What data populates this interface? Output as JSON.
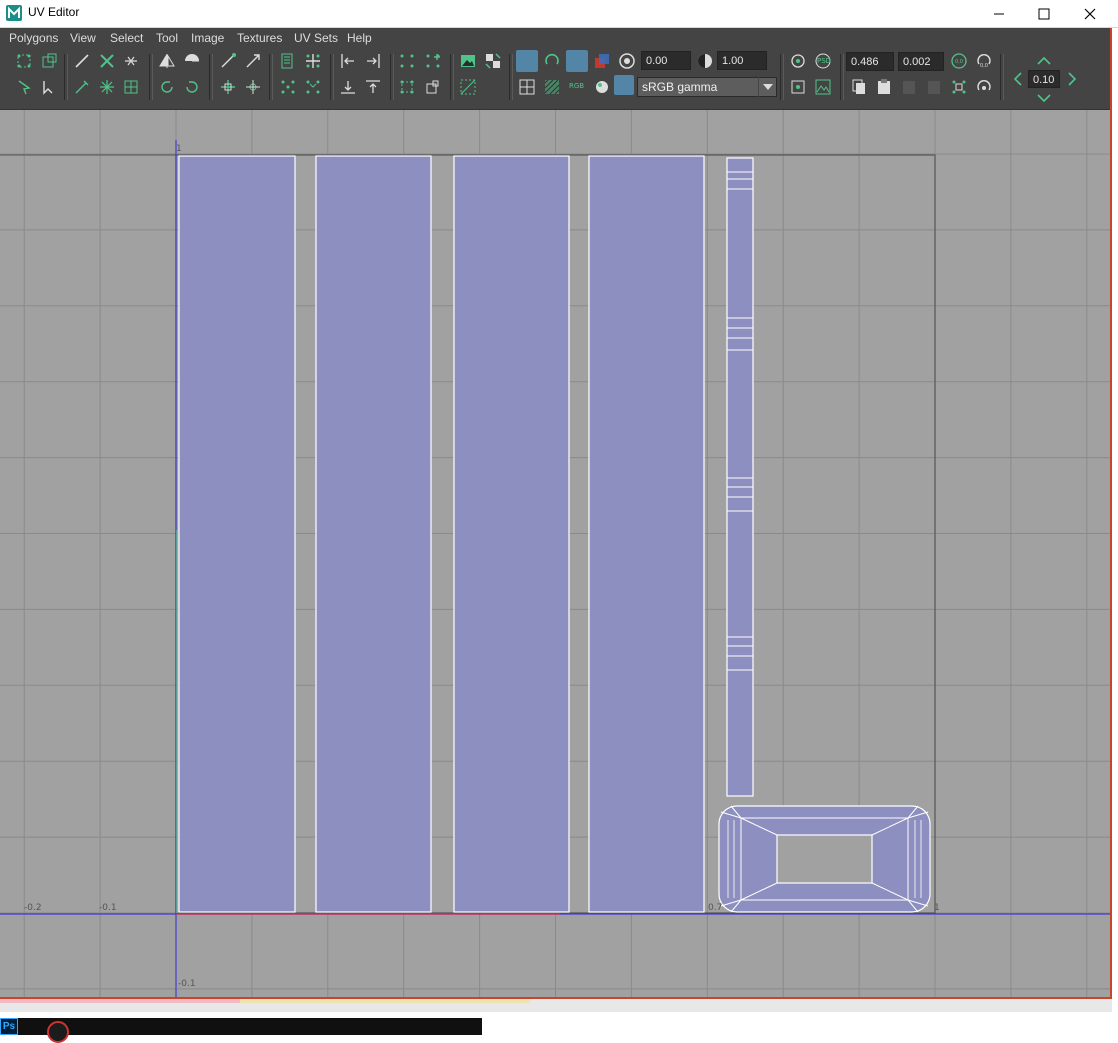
{
  "window": {
    "title": "UV Editor",
    "app_icon": "maya-icon"
  },
  "window_controls": [
    {
      "name": "minimize",
      "icon": "minimize-icon"
    },
    {
      "name": "maximize",
      "icon": "maximize-icon"
    },
    {
      "name": "close",
      "icon": "close-icon"
    }
  ],
  "menu": [
    "Polygons",
    "View",
    "Select",
    "Tool",
    "Image",
    "Textures",
    "UV Sets",
    "Help"
  ],
  "toolbar": {
    "exposure": "0.00",
    "gamma": "1.00",
    "colorspace": "sRGB gamma",
    "rgb_label": "RGB",
    "psd_label": "PSD",
    "u_value": "0.486",
    "v_value": "0.002",
    "step_value": "0.10",
    "icon_color": "#4fc48a",
    "active_color": "#5285a6"
  },
  "viewport": {
    "background": "#a1a1a1",
    "uv_fill": "#8c8fbf",
    "axis_labels": [
      "-0.2",
      "-0.1",
      "0.7",
      "1",
      "-0.1",
      "1"
    ]
  },
  "taskbar": {
    "photoshop_label": "Ps"
  }
}
